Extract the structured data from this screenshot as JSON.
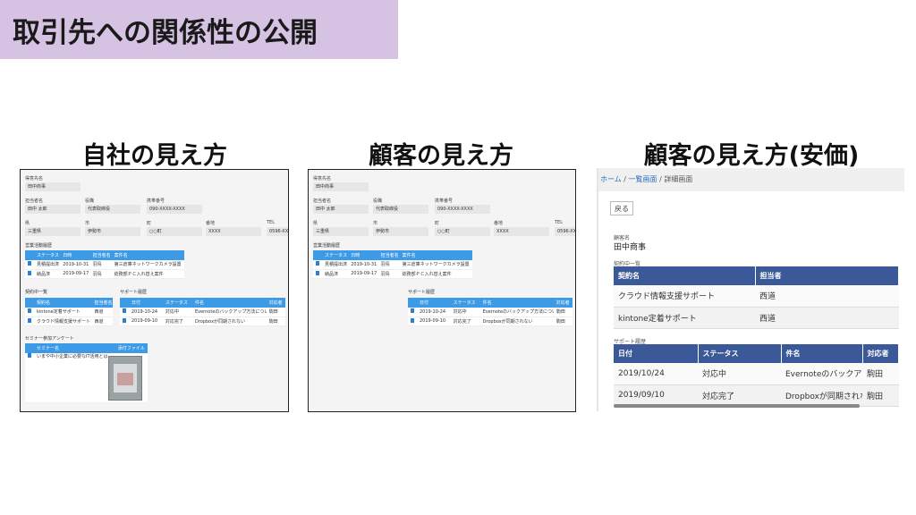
{
  "slide_title": "取引先への関係性の公開",
  "panels": {
    "own": "自社の見え方",
    "customer": "顧客の見え方",
    "customer_cheap": "顧客の見え方(安価)"
  },
  "form": {
    "client_name_label": "得意先名",
    "client_name": "田中商事",
    "person_label": "担当者名",
    "person": "田中 太郎",
    "title_label": "役職",
    "title": "代表取締役",
    "mobile_label": "携帯番号",
    "mobile": "090-XXXX-XXXX",
    "pref_label": "県",
    "pref": "三重県",
    "city_label": "市",
    "city": "伊勢市",
    "town_label": "町",
    "town": "○○町",
    "addr_label": "番地",
    "addr": "XXXX",
    "tel_label": "TEL",
    "tel": "0596-XX"
  },
  "sales": {
    "heading": "営業活動履歴",
    "columns": [
      "ステータス",
      "日時",
      "担当者名",
      "案件名"
    ],
    "rows": [
      [
        "見積提出済",
        "2019-10-31",
        "羽鳥",
        "第三倉庫ネットワークカメラ設置"
      ],
      [
        "納品済",
        "2019-09-17",
        "羽鳥",
        "総務部ＰＣ入れ替え案件"
      ]
    ]
  },
  "contract": {
    "heading": "契約中一覧",
    "columns": [
      "契約名",
      "担当者名"
    ],
    "rows": [
      [
        "kintone定着サポート",
        "西道"
      ],
      [
        "クラウド情報支援サポート",
        "西道"
      ]
    ]
  },
  "support": {
    "heading": "サポート履歴",
    "columns": [
      "日付",
      "ステータス",
      "件名",
      "対応者"
    ],
    "rows": [
      [
        "2019-10-24",
        "対応中",
        "Evernoteのバックアップ方法について",
        "駒田"
      ],
      [
        "2019-09-10",
        "対応完了",
        "Dropboxが同期されない",
        "駒田"
      ]
    ]
  },
  "seminar": {
    "heading": "セミナー参加アンケート",
    "columns": [
      "セミナー名",
      "添付ファイル"
    ],
    "rows": [
      [
        "いまや中小企業に必要なIT活用とは"
      ]
    ]
  },
  "cheap": {
    "breadcrumb": {
      "home": "ホーム",
      "sep": " / ",
      "list": "一覧画面",
      "detail": "詳細画面"
    },
    "back": "戻る",
    "client_label": "顧客名",
    "client": "田中商事",
    "contract_heading": "契約中一覧",
    "contract_columns": [
      "契約名",
      "担当者"
    ],
    "contract_rows": [
      [
        "クラウド情報支援サポート",
        "西道"
      ],
      [
        "kintone定着サポート",
        "西道"
      ]
    ],
    "support_heading": "サポート履歴",
    "support_columns": [
      "日付",
      "ステータス",
      "件名",
      "対応者"
    ],
    "support_rows": [
      [
        "2019/10/24",
        "対応中",
        "Evernoteのバックアップ",
        "駒田"
      ],
      [
        "2019/09/10",
        "対応完了",
        "Dropboxが同期されない",
        "駒田"
      ]
    ]
  }
}
